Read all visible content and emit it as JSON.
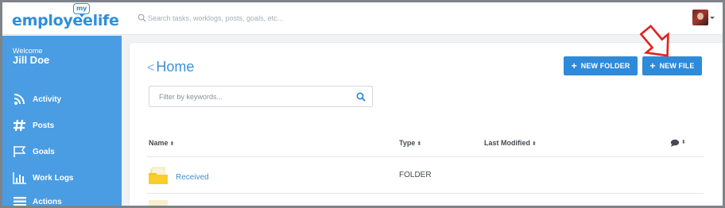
{
  "brand": {
    "logo_word": "employeelife",
    "logo_bubble": "my",
    "color": "#2f8fd8"
  },
  "search": {
    "placeholder": "Search tasks, worklogs, posts, goals, etc...",
    "icon": "search-icon"
  },
  "user_menu": {
    "avatar": "avatar",
    "caret_icon": "caret-down-icon"
  },
  "sidebar": {
    "welcome": "Welcome",
    "user_name": "Jill Doe",
    "background": "#4a9de3",
    "items": [
      {
        "label": "Activity",
        "icon": "rss-icon"
      },
      {
        "label": "Posts",
        "icon": "hashtag-icon"
      },
      {
        "label": "Goals",
        "icon": "flag-icon"
      },
      {
        "label": "Work Logs",
        "icon": "bar-chart-icon"
      },
      {
        "label": "Actions",
        "icon": "list-icon"
      }
    ]
  },
  "main": {
    "back_icon": "chevron-left-icon",
    "title": "Home",
    "buttons": {
      "new_folder": "NEW FOLDER",
      "new_file": "NEW FILE",
      "plus": "+"
    },
    "filter_placeholder": "Filter by keywords...",
    "table": {
      "sort_glyph": "⬍",
      "columns": {
        "name": "Name",
        "type": "Type",
        "last_modified": "Last Modified",
        "comments_icon": "comment-icon"
      },
      "rows": [
        {
          "name": "Received",
          "type": "FOLDER",
          "last_modified": "",
          "icon": "folder-icon"
        }
      ]
    },
    "accent": "#2f8ad9"
  },
  "annotation": {
    "icon": "red-arrow-icon",
    "color": "#e0231b"
  }
}
